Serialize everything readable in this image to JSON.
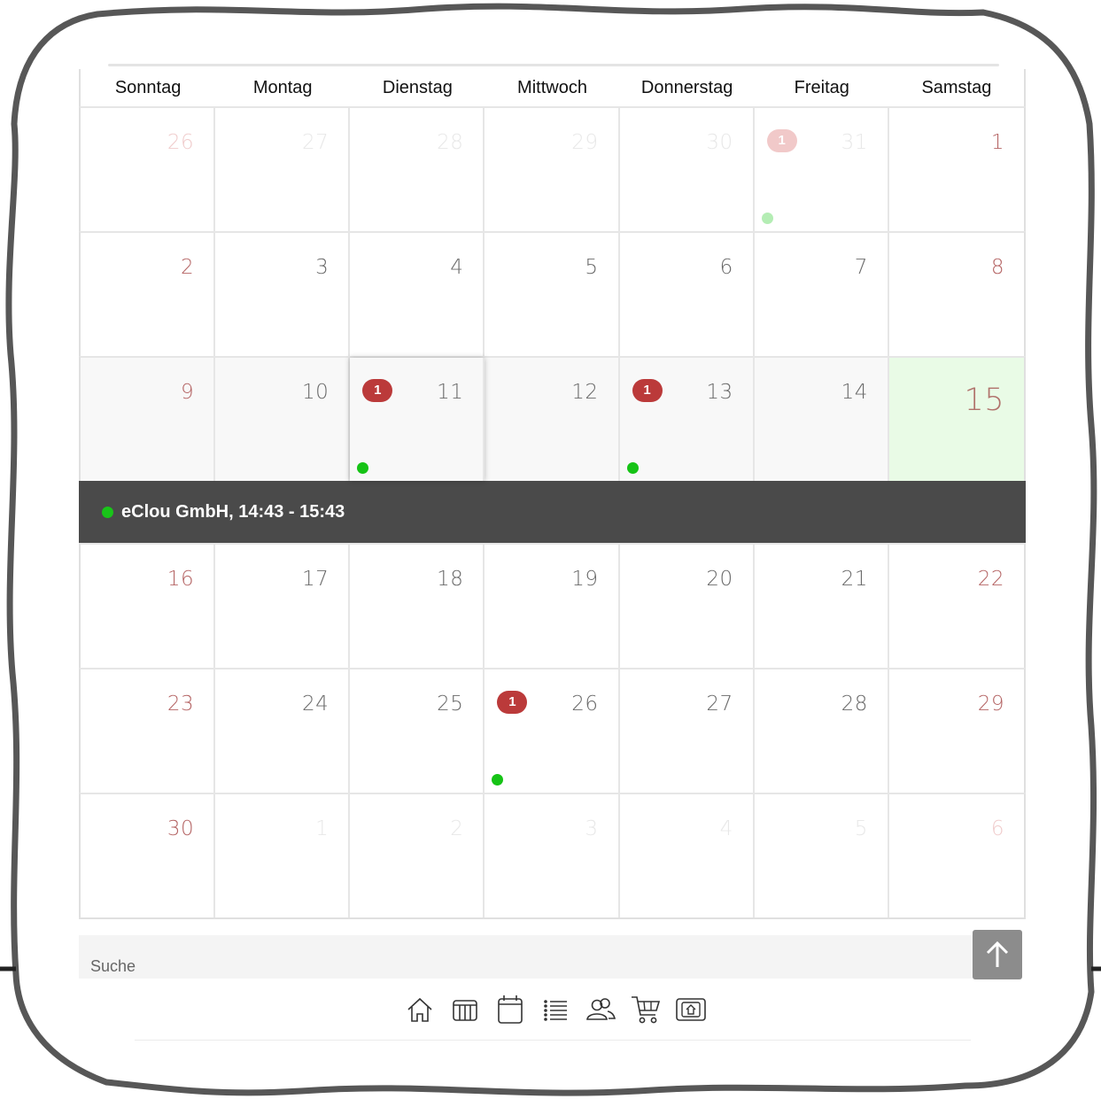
{
  "weekdays": [
    "Sonntag",
    "Montag",
    "Dienstag",
    "Mittwoch",
    "Donnerstag",
    "Freitag",
    "Samstag"
  ],
  "weeks": [
    [
      {
        "day": "26",
        "weekend": true,
        "faded": true
      },
      {
        "day": "27",
        "faded": true
      },
      {
        "day": "28",
        "faded": true
      },
      {
        "day": "29",
        "faded": true
      },
      {
        "day": "30",
        "faded": true
      },
      {
        "day": "31",
        "faded": true,
        "badge": "1",
        "dot": true
      },
      {
        "day": "1",
        "weekend": true
      }
    ],
    [
      {
        "day": "2",
        "weekend": true
      },
      {
        "day": "3"
      },
      {
        "day": "4"
      },
      {
        "day": "5"
      },
      {
        "day": "6"
      },
      {
        "day": "7"
      },
      {
        "day": "8",
        "weekend": true
      }
    ],
    [
      {
        "day": "9",
        "weekend": true
      },
      {
        "day": "10"
      },
      {
        "day": "11",
        "badge": "1",
        "dot": true,
        "active": true
      },
      {
        "day": "12"
      },
      {
        "day": "13",
        "badge": "1",
        "dot": true
      },
      {
        "day": "14"
      },
      {
        "day": "15",
        "weekend": true,
        "today": true
      }
    ],
    [
      {
        "day": "16",
        "weekend": true
      },
      {
        "day": "17"
      },
      {
        "day": "18"
      },
      {
        "day": "19"
      },
      {
        "day": "20"
      },
      {
        "day": "21"
      },
      {
        "day": "22",
        "weekend": true
      }
    ],
    [
      {
        "day": "23",
        "weekend": true
      },
      {
        "day": "24"
      },
      {
        "day": "25"
      },
      {
        "day": "26",
        "badge": "1",
        "dot": true
      },
      {
        "day": "27"
      },
      {
        "day": "28"
      },
      {
        "day": "29",
        "weekend": true
      }
    ],
    [
      {
        "day": "30",
        "weekend": true
      },
      {
        "day": "1",
        "faded": true
      },
      {
        "day": "2",
        "faded": true
      },
      {
        "day": "3",
        "faded": true
      },
      {
        "day": "4",
        "faded": true
      },
      {
        "day": "5",
        "faded": true
      },
      {
        "day": "6",
        "weekend": true,
        "faded": true
      }
    ]
  ],
  "selected_week_index": 2,
  "event": {
    "text": "eClou GmbH, 14:43 - 15:43",
    "status_color": "#19c519"
  },
  "search": {
    "placeholder": "Suche",
    "icon": "search-icon"
  },
  "scroll_top": {
    "icon": "arrow-up-icon"
  },
  "nav_icons": [
    "home-icon",
    "table-icon",
    "calendar-icon",
    "list-icon",
    "users-icon",
    "cart-icon",
    "upload-icon"
  ],
  "colors": {
    "badge": "#bb3a3a",
    "dot": "#16c316",
    "event_bar": "#4a4a4a",
    "today_bg": "#e9fbe6",
    "weekend_text": "#b56565"
  }
}
